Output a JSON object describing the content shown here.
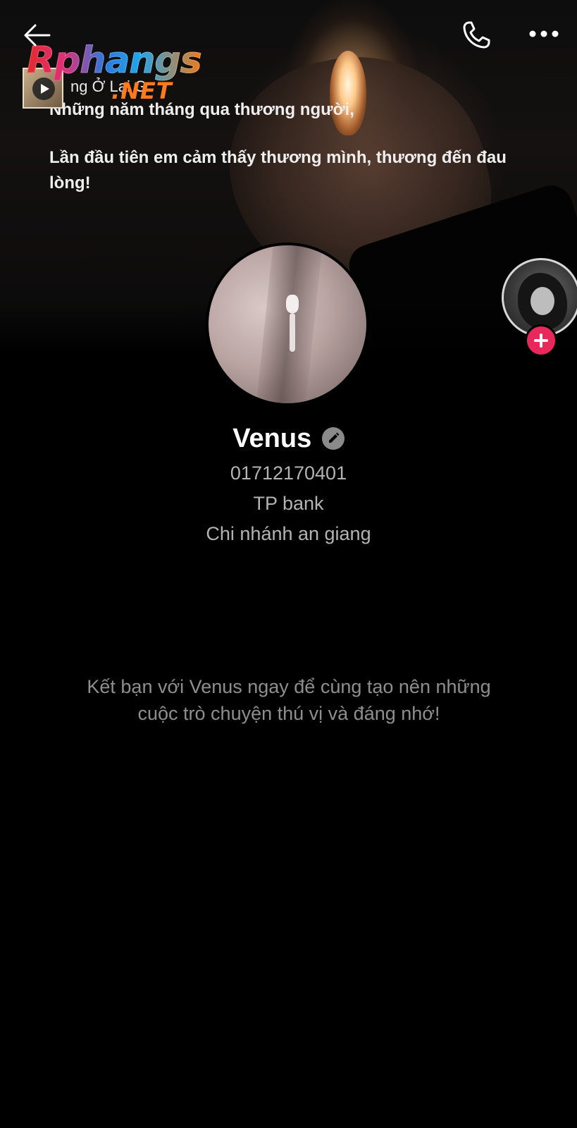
{
  "cover": {
    "caption_lines": [
      "Những năm tháng qua thương người,",
      "Lần đầu tiên em cảm thấy thương mình, thương đến đau lòng!"
    ]
  },
  "music": {
    "title": "ng Ở Lại G",
    "play_icon": "play-icon"
  },
  "watermark": {
    "brand": "Rphangs",
    "suffix": ".NET"
  },
  "topbar": {
    "back_icon": "arrow-left-icon",
    "call_icon": "phone-icon",
    "more_icon": "more-dots-icon"
  },
  "profile": {
    "name": "Venus",
    "edit_icon": "pencil-icon",
    "details": [
      "01712170401",
      "TP bank",
      "Chi nhánh an giang"
    ]
  },
  "story": {
    "add_icon": "plus-icon",
    "add_color": "#e8285a"
  },
  "prompt": {
    "line1": "Kết bạn với Venus ngay để cùng tạo nên những",
    "line2": "cuộc trò chuyện thú vị và đáng nhớ!"
  }
}
